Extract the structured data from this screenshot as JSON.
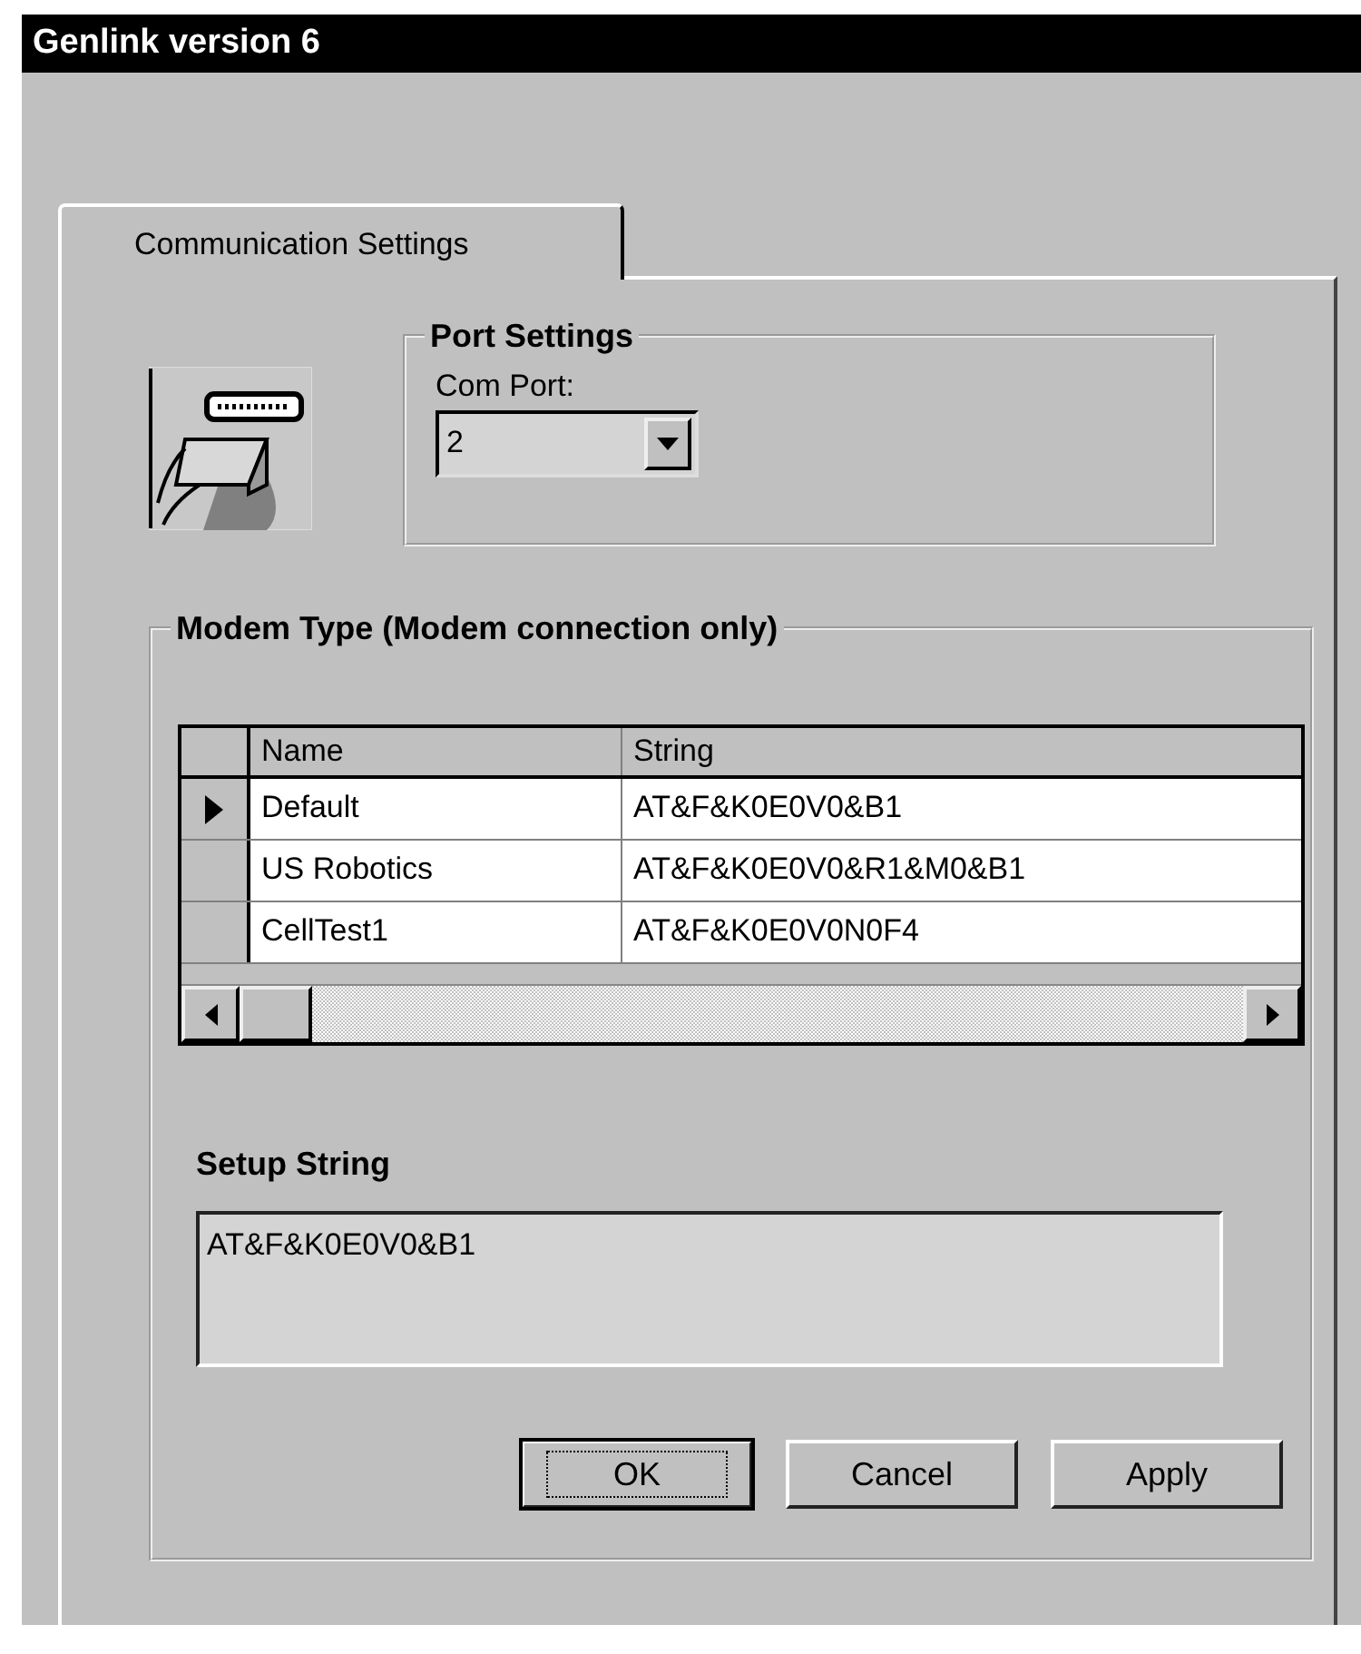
{
  "window": {
    "title": "Genlink version 6"
  },
  "tabs": [
    {
      "label": "Communication Settings",
      "selected": true
    }
  ],
  "port_settings": {
    "title": "Port Settings",
    "com_port_label": "Com Port:",
    "com_port_value": "2"
  },
  "modem_type": {
    "title": "Modem Type (Modem connection only)",
    "columns": [
      "Name",
      "String"
    ],
    "rows": [
      {
        "name": "Default",
        "string": "AT&F&K0E0V0&B1",
        "selected": true
      },
      {
        "name": "US Robotics",
        "string": "AT&F&K0E0V0&R1&M0&B1",
        "selected": false
      },
      {
        "name": "CellTest1",
        "string": "AT&F&K0E0V0N0F4",
        "selected": false
      }
    ]
  },
  "setup_string": {
    "label": "Setup String",
    "value": "AT&F&K0E0V0&B1"
  },
  "buttons": [
    {
      "label": "OK",
      "default": true
    },
    {
      "label": "Cancel",
      "default": false
    },
    {
      "label": "Apply",
      "default": false
    }
  ]
}
